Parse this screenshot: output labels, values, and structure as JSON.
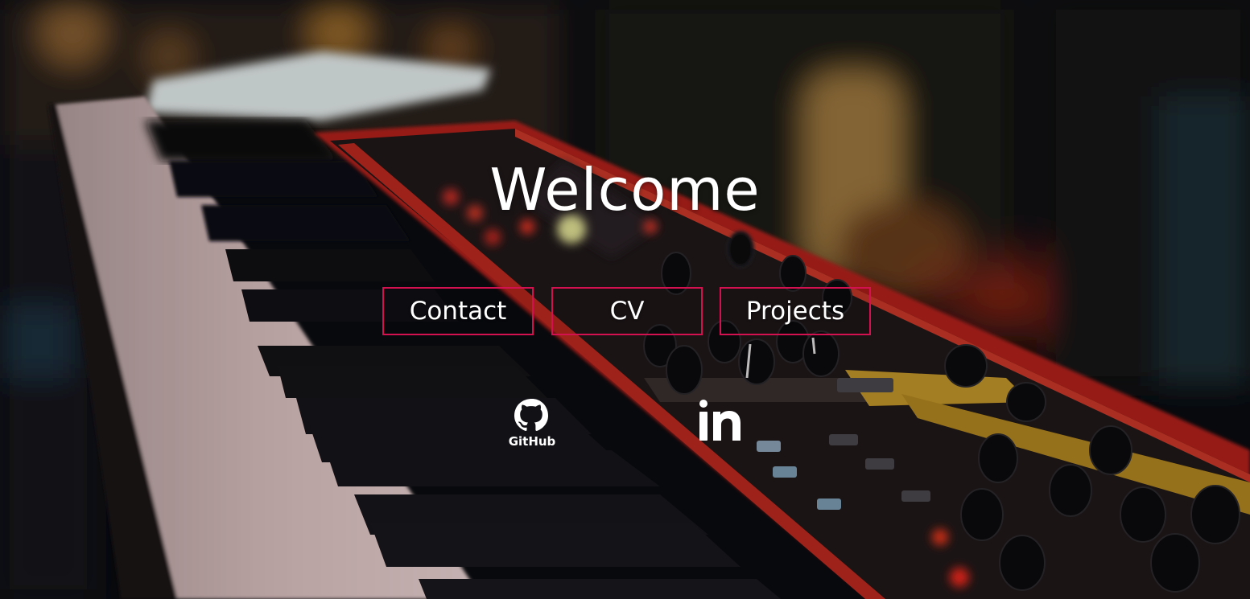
{
  "hero": {
    "title": "Welcome"
  },
  "nav": {
    "buttons": [
      {
        "label": "Contact"
      },
      {
        "label": "CV"
      },
      {
        "label": "Projects"
      }
    ],
    "border_color": "#d31150"
  },
  "social": {
    "github": {
      "label": "GitHub",
      "icon": "github-icon"
    },
    "linkedin": {
      "label": "in",
      "icon": "linkedin-icon"
    }
  },
  "background": {
    "subject": "keyboard-synthesizer-photo",
    "accent": "#c8281e"
  }
}
